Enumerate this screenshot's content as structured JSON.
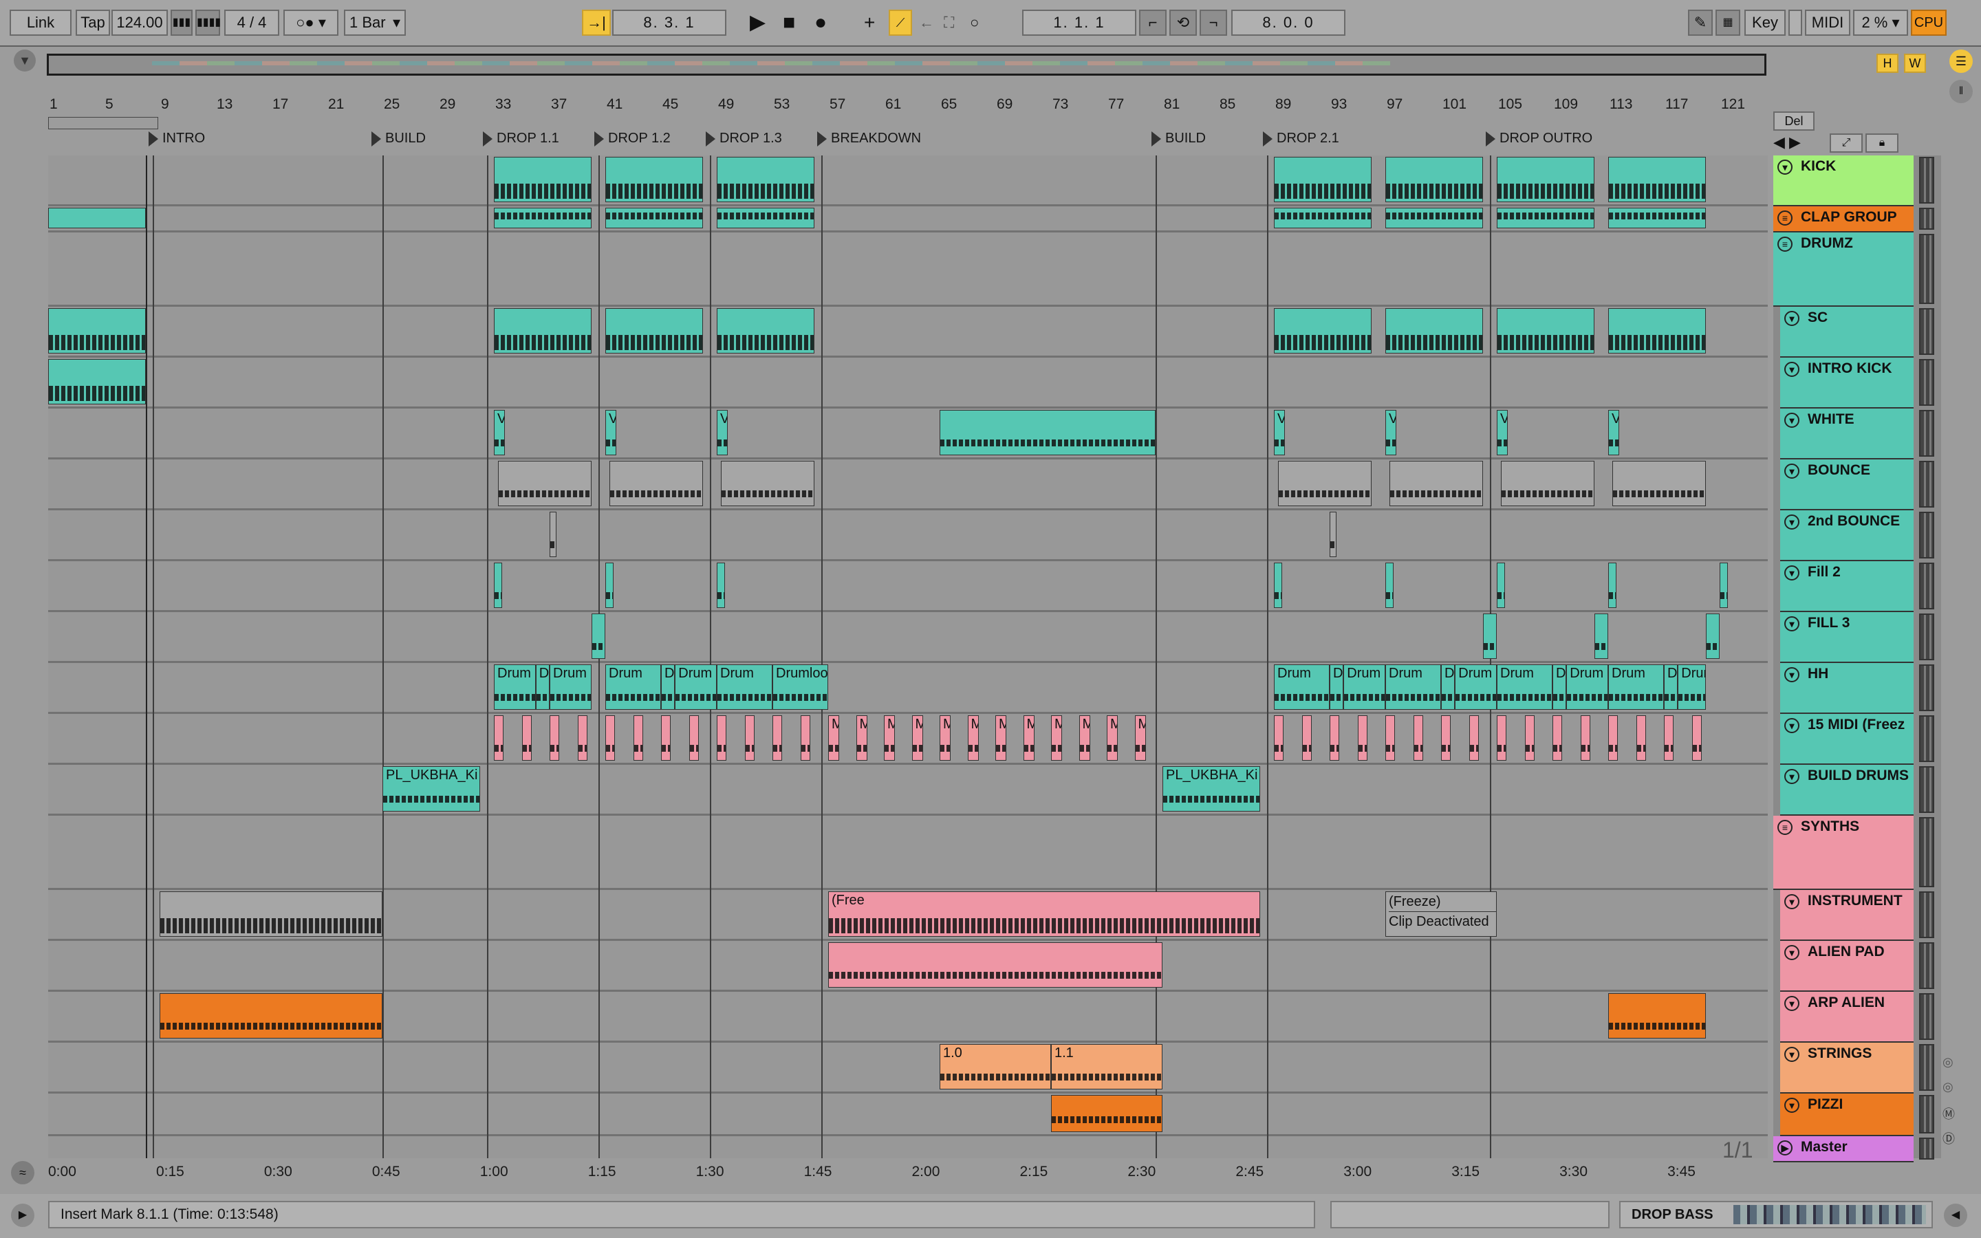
{
  "transport": {
    "link": "Link",
    "tap": "Tap",
    "tempo": "124.00",
    "signature": "4 / 4",
    "quantize": "1 Bar",
    "position": "8.   3.   1",
    "loop_start": "1.   1.   1",
    "loop_length": "8.   0.   0",
    "key": "Key",
    "midi": "MIDI",
    "cpu_percent": "2 %",
    "cpu": "CPU"
  },
  "overview": {
    "h_button": "H",
    "w_button": "W"
  },
  "ruler_bars": [
    "1",
    "5",
    "9",
    "13",
    "17",
    "21",
    "25",
    "29",
    "33",
    "37",
    "41",
    "45",
    "49",
    "53",
    "57",
    "61",
    "65",
    "69",
    "73",
    "77",
    "81",
    "85",
    "89",
    "93",
    "97",
    "101",
    "105",
    "109",
    "113",
    "117",
    "121"
  ],
  "locators": [
    "INTRO",
    "BUILD",
    "DROP 1.1",
    "DROP 1.2",
    "DROP 1.3",
    "BREAKDOWN",
    "BUILD",
    "DROP 2.1",
    "DROP OUTRO"
  ],
  "tracks": [
    {
      "name": "KICK",
      "color": "#a5f07a"
    },
    {
      "name": "CLAP GROUP",
      "color": "#ec7a21"
    },
    {
      "name": "DRUMZ",
      "color": "#56c7b3"
    },
    {
      "name": "SC",
      "color": "#56c7b3"
    },
    {
      "name": "INTRO KICK",
      "color": "#56c7b3"
    },
    {
      "name": "WHITE",
      "color": "#56c7b3"
    },
    {
      "name": "BOUNCE",
      "color": "#56c7b3"
    },
    {
      "name": "2nd BOUNCE",
      "color": "#56c7b3"
    },
    {
      "name": "Fill 2",
      "color": "#56c7b3"
    },
    {
      "name": "FILL 3",
      "color": "#56c7b3"
    },
    {
      "name": "HH",
      "color": "#56c7b3"
    },
    {
      "name": "15 MIDI  (Freez",
      "color": "#56c7b3"
    },
    {
      "name": "BUILD DRUMS",
      "color": "#56c7b3"
    },
    {
      "name": "SYNTHS",
      "color": "#ee96a5"
    },
    {
      "name": "INSTRUMENT",
      "color": "#ee96a5"
    },
    {
      "name": "ALIEN PAD",
      "color": "#ee96a5"
    },
    {
      "name": "ARP ALIEN",
      "color": "#ee96a5"
    },
    {
      "name": "STRINGS",
      "color": "#f3a775"
    },
    {
      "name": "PIZZI",
      "color": "#ec7a21"
    },
    {
      "name": "Master",
      "color": "#d47ee0"
    }
  ],
  "del_button": "Del",
  "clip_labels": {
    "drum": "Drum",
    "drum_d": "D",
    "drumloop": "Drumloo",
    "kit": "PL_UKBHA_Ki",
    "freeze": "(Freeze)",
    "freeze_short": "(Free",
    "clip_deactivated": "Clip Deactivated",
    "strings_a": "1.0",
    "strings_b": "1.1",
    "midi_m": "M",
    "fill_v": "V"
  },
  "time_ruler": [
    "0:00",
    "0:15",
    "0:30",
    "0:45",
    "1:00",
    "1:15",
    "1:30",
    "1:45",
    "2:00",
    "2:15",
    "2:30",
    "2:45",
    "3:00",
    "3:15",
    "3:30",
    "3:45"
  ],
  "page_indicator": "1/1",
  "status": {
    "message": "Insert Mark 8.1.1 (Time: 0:13:548)",
    "track_name": "DROP BASS"
  },
  "colors": {
    "teal": "#56c7b3",
    "pink": "#ee96a5",
    "orange": "#ec7a21",
    "light_orange": "#f3a775",
    "green": "#a5f07a",
    "purple": "#d47ee0",
    "accent_yellow": "#f2c53d"
  }
}
